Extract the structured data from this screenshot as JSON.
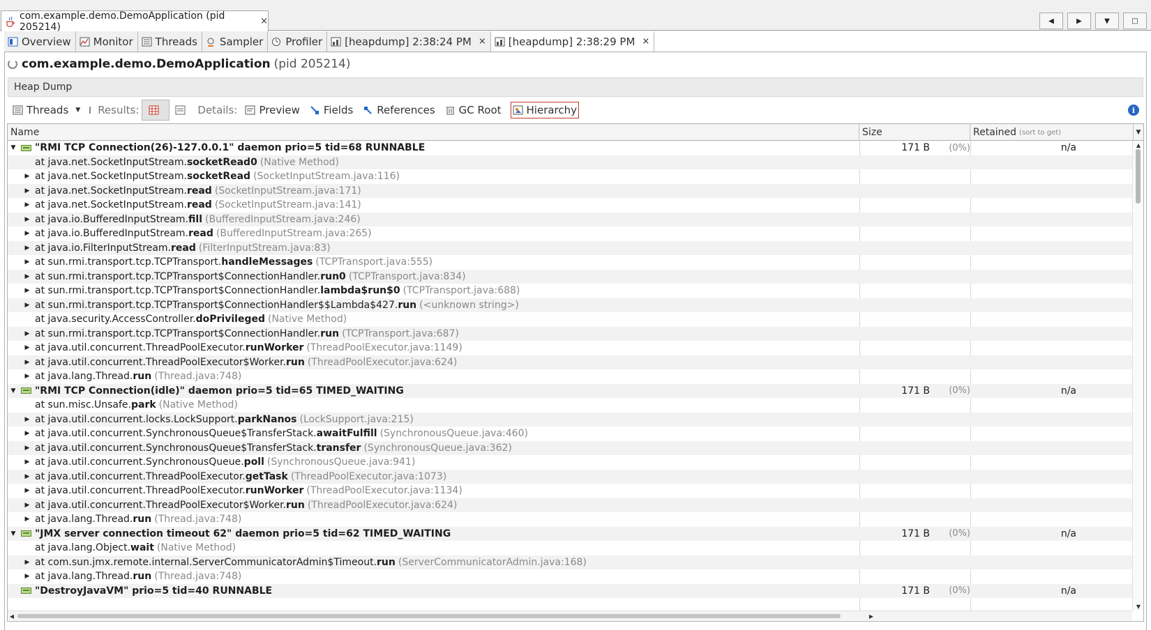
{
  "window": {
    "doc_tab_title": "com.example.demo.DemoApplication (pid 205214)",
    "close_glyph": "×"
  },
  "view_tabs": [
    {
      "label": "Overview",
      "icon": "overview-icon"
    },
    {
      "label": "Monitor",
      "icon": "monitor-icon"
    },
    {
      "label": "Threads",
      "icon": "threads-icon"
    },
    {
      "label": "Sampler",
      "icon": "sampler-icon"
    },
    {
      "label": "Profiler",
      "icon": "profiler-icon"
    },
    {
      "label": "[heapdump] 2:38:24 PM",
      "icon": "heapdump-icon",
      "closable": true
    },
    {
      "label": "[heapdump] 2:38:29 PM",
      "icon": "heapdump-icon",
      "closable": true
    }
  ],
  "app": {
    "name": "com.example.demo.DemoApplication",
    "pid": "(pid 205214)"
  },
  "heap_header": "Heap Dump",
  "toolbar": {
    "threads": "Threads",
    "results": "Results:",
    "details": "Details:",
    "preview": "Preview",
    "fields": "Fields",
    "references": "References",
    "gc_root": "GC Root",
    "hierarchy": "Hierarchy",
    "info": "i"
  },
  "columns": {
    "name": "Name",
    "size": "Size",
    "retained": "Retained",
    "retained_hint": "(sort to get)"
  },
  "rows": [
    {
      "type": "thread",
      "name": "\"RMI TCP Connection(26)-127.0.0.1\" daemon prio=5 tid=68 RUNNABLE",
      "size": "171 B",
      "pct": "(0%)",
      "retained": "n/a"
    },
    {
      "type": "frame",
      "expandable": false,
      "prefix": "at java.net.SocketInputStream.",
      "method": "socketRead0",
      "src": "(Native Method)"
    },
    {
      "type": "frame",
      "expandable": true,
      "prefix": "at java.net.SocketInputStream.",
      "method": "socketRead",
      "src": "(SocketInputStream.java:116)"
    },
    {
      "type": "frame",
      "expandable": true,
      "prefix": "at java.net.SocketInputStream.",
      "method": "read",
      "src": "(SocketInputStream.java:171)"
    },
    {
      "type": "frame",
      "expandable": true,
      "prefix": "at java.net.SocketInputStream.",
      "method": "read",
      "src": "(SocketInputStream.java:141)"
    },
    {
      "type": "frame",
      "expandable": true,
      "prefix": "at java.io.BufferedInputStream.",
      "method": "fill",
      "src": "(BufferedInputStream.java:246)"
    },
    {
      "type": "frame",
      "expandable": true,
      "prefix": "at java.io.BufferedInputStream.",
      "method": "read",
      "src": "(BufferedInputStream.java:265)"
    },
    {
      "type": "frame",
      "expandable": true,
      "prefix": "at java.io.FilterInputStream.",
      "method": "read",
      "src": "(FilterInputStream.java:83)"
    },
    {
      "type": "frame",
      "expandable": true,
      "prefix": "at sun.rmi.transport.tcp.TCPTransport.",
      "method": "handleMessages",
      "src": "(TCPTransport.java:555)"
    },
    {
      "type": "frame",
      "expandable": true,
      "prefix": "at sun.rmi.transport.tcp.TCPTransport$ConnectionHandler.",
      "method": "run0",
      "src": "(TCPTransport.java:834)"
    },
    {
      "type": "frame",
      "expandable": true,
      "prefix": "at sun.rmi.transport.tcp.TCPTransport$ConnectionHandler.",
      "method": "lambda$run$0",
      "src": "(TCPTransport.java:688)"
    },
    {
      "type": "frame",
      "expandable": true,
      "prefix": "at sun.rmi.transport.tcp.TCPTransport$ConnectionHandler$$Lambda$427.",
      "method": "run",
      "src": "(<unknown string>)"
    },
    {
      "type": "frame",
      "expandable": false,
      "prefix": "at java.security.AccessController.",
      "method": "doPrivileged",
      "src": "(Native Method)"
    },
    {
      "type": "frame",
      "expandable": true,
      "prefix": "at sun.rmi.transport.tcp.TCPTransport$ConnectionHandler.",
      "method": "run",
      "src": "(TCPTransport.java:687)"
    },
    {
      "type": "frame",
      "expandable": true,
      "prefix": "at java.util.concurrent.ThreadPoolExecutor.",
      "method": "runWorker",
      "src": "(ThreadPoolExecutor.java:1149)"
    },
    {
      "type": "frame",
      "expandable": true,
      "prefix": "at java.util.concurrent.ThreadPoolExecutor$Worker.",
      "method": "run",
      "src": "(ThreadPoolExecutor.java:624)"
    },
    {
      "type": "frame",
      "expandable": true,
      "prefix": "at java.lang.Thread.",
      "method": "run",
      "src": "(Thread.java:748)"
    },
    {
      "type": "thread",
      "name": "\"RMI TCP Connection(idle)\" daemon prio=5 tid=65 TIMED_WAITING",
      "size": "171 B",
      "pct": "(0%)",
      "retained": "n/a"
    },
    {
      "type": "frame",
      "expandable": false,
      "prefix": "at sun.misc.Unsafe.",
      "method": "park",
      "src": "(Native Method)"
    },
    {
      "type": "frame",
      "expandable": true,
      "prefix": "at java.util.concurrent.locks.LockSupport.",
      "method": "parkNanos",
      "src": "(LockSupport.java:215)"
    },
    {
      "type": "frame",
      "expandable": true,
      "prefix": "at java.util.concurrent.SynchronousQueue$TransferStack.",
      "method": "awaitFulfill",
      "src": "(SynchronousQueue.java:460)"
    },
    {
      "type": "frame",
      "expandable": true,
      "prefix": "at java.util.concurrent.SynchronousQueue$TransferStack.",
      "method": "transfer",
      "src": "(SynchronousQueue.java:362)"
    },
    {
      "type": "frame",
      "expandable": true,
      "prefix": "at java.util.concurrent.SynchronousQueue.",
      "method": "poll",
      "src": "(SynchronousQueue.java:941)"
    },
    {
      "type": "frame",
      "expandable": true,
      "prefix": "at java.util.concurrent.ThreadPoolExecutor.",
      "method": "getTask",
      "src": "(ThreadPoolExecutor.java:1073)"
    },
    {
      "type": "frame",
      "expandable": true,
      "prefix": "at java.util.concurrent.ThreadPoolExecutor.",
      "method": "runWorker",
      "src": "(ThreadPoolExecutor.java:1134)"
    },
    {
      "type": "frame",
      "expandable": true,
      "prefix": "at java.util.concurrent.ThreadPoolExecutor$Worker.",
      "method": "run",
      "src": "(ThreadPoolExecutor.java:624)"
    },
    {
      "type": "frame",
      "expandable": true,
      "prefix": "at java.lang.Thread.",
      "method": "run",
      "src": "(Thread.java:748)"
    },
    {
      "type": "thread",
      "name": "\"JMX server connection timeout 62\" daemon prio=5 tid=62 TIMED_WAITING",
      "size": "171 B",
      "pct": "(0%)",
      "retained": "n/a"
    },
    {
      "type": "frame",
      "expandable": false,
      "prefix": "at java.lang.Object.",
      "method": "wait",
      "src": "(Native Method)"
    },
    {
      "type": "frame",
      "expandable": true,
      "prefix": "at com.sun.jmx.remote.internal.ServerCommunicatorAdmin$Timeout.",
      "method": "run",
      "src": "(ServerCommunicatorAdmin.java:168)"
    },
    {
      "type": "frame",
      "expandable": true,
      "prefix": "at java.lang.Thread.",
      "method": "run",
      "src": "(Thread.java:748)"
    },
    {
      "type": "thread",
      "expanded": false,
      "name": "\"DestroyJavaVM\" prio=5 tid=40 RUNNABLE",
      "size": "171 B",
      "pct": "(0%)",
      "retained": "n/a"
    }
  ]
}
